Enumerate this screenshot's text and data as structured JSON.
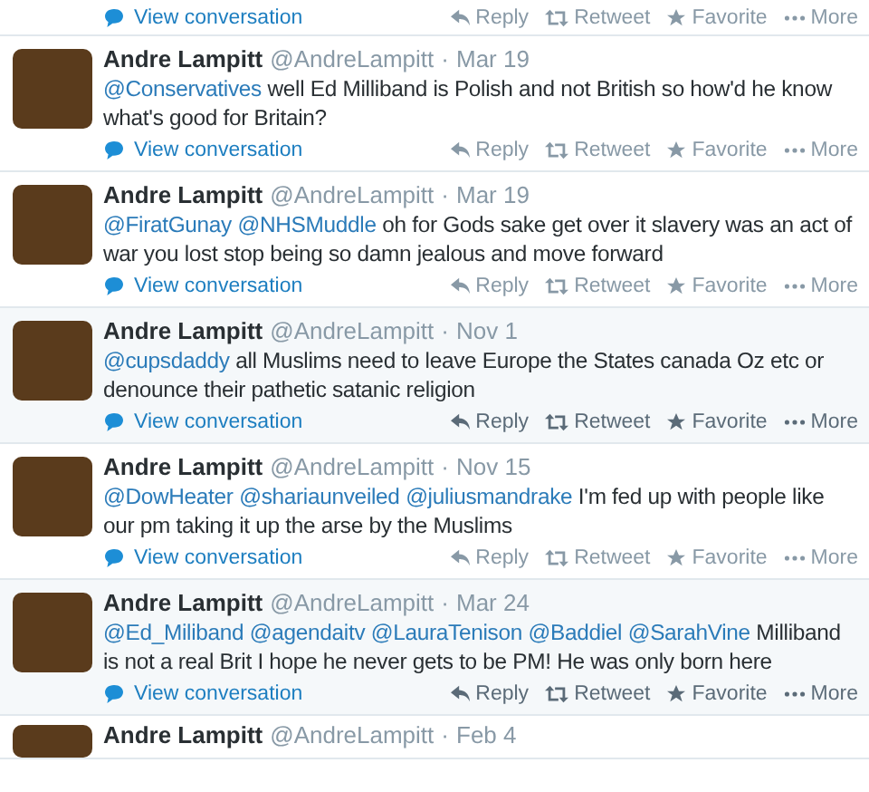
{
  "tweets": [
    {
      "hovered": false,
      "view_conversation": "View conversation",
      "actions": [
        {
          "kind": "reply",
          "label": "Reply"
        },
        {
          "kind": "retweet",
          "label": "Retweet"
        },
        {
          "kind": "favorite",
          "label": "Favorite"
        },
        {
          "kind": "more",
          "label": "More"
        }
      ]
    },
    {
      "hovered": false,
      "name": "Andre Lampitt",
      "handle": "@AndreLampitt",
      "separator": "·",
      "date": "Mar 19",
      "mentions": [
        "@Conservatives"
      ],
      "text": "well Ed Milliband is Polish and not British so how'd he know what's good for Britain?",
      "view_conversation": "View conversation",
      "actions": [
        {
          "kind": "reply",
          "label": "Reply"
        },
        {
          "kind": "retweet",
          "label": "Retweet"
        },
        {
          "kind": "favorite",
          "label": "Favorite"
        },
        {
          "kind": "more",
          "label": "More"
        }
      ]
    },
    {
      "hovered": false,
      "name": "Andre Lampitt",
      "handle": "@AndreLampitt",
      "separator": "·",
      "date": "Mar 19",
      "mentions": [
        "@FiratGunay",
        "@NHSMuddle"
      ],
      "text": "oh for Gods sake get over it slavery was an act of war you lost stop being so damn jealous and move forward",
      "view_conversation": "View conversation",
      "actions": [
        {
          "kind": "reply",
          "label": "Reply"
        },
        {
          "kind": "retweet",
          "label": "Retweet"
        },
        {
          "kind": "favorite",
          "label": "Favorite"
        },
        {
          "kind": "more",
          "label": "More"
        }
      ]
    },
    {
      "hovered": true,
      "name": "Andre Lampitt",
      "handle": "@AndreLampitt",
      "separator": "·",
      "date": "Nov 1",
      "mentions": [
        "@cupsdaddy"
      ],
      "text": "all Muslims need to leave Europe the States canada Oz etc or denounce their pathetic satanic religion",
      "view_conversation": "View conversation",
      "actions": [
        {
          "kind": "reply",
          "label": "Reply"
        },
        {
          "kind": "retweet",
          "label": "Retweet"
        },
        {
          "kind": "favorite",
          "label": "Favorite"
        },
        {
          "kind": "more",
          "label": "More"
        }
      ]
    },
    {
      "hovered": false,
      "name": "Andre Lampitt",
      "handle": "@AndreLampitt",
      "separator": "·",
      "date": "Nov 15",
      "mentions": [
        "@DowHeater",
        "@shariaunveiled",
        "@juliusmandrake"
      ],
      "text": "I'm fed up with people like our pm taking it up the arse by the Muslims",
      "view_conversation": "View conversation",
      "actions": [
        {
          "kind": "reply",
          "label": "Reply"
        },
        {
          "kind": "retweet",
          "label": "Retweet"
        },
        {
          "kind": "favorite",
          "label": "Favorite"
        },
        {
          "kind": "more",
          "label": "More"
        }
      ]
    },
    {
      "hovered": true,
      "name": "Andre Lampitt",
      "handle": "@AndreLampitt",
      "separator": "·",
      "date": "Mar 24",
      "mentions": [
        "@Ed_Miliband",
        "@agendaitv",
        "@LauraTenison",
        "@Baddiel",
        "@SarahVine"
      ],
      "text": "Milliband is not a real Brit I hope he never gets to be PM! He was only born here",
      "view_conversation": "View conversation",
      "actions": [
        {
          "kind": "reply",
          "label": "Reply"
        },
        {
          "kind": "retweet",
          "label": "Retweet"
        },
        {
          "kind": "favorite",
          "label": "Favorite"
        },
        {
          "kind": "more",
          "label": "More"
        }
      ]
    },
    {
      "name": "Andre Lampitt",
      "handle": "@AndreLampitt",
      "separator": "·",
      "date": "Feb 4"
    }
  ]
}
